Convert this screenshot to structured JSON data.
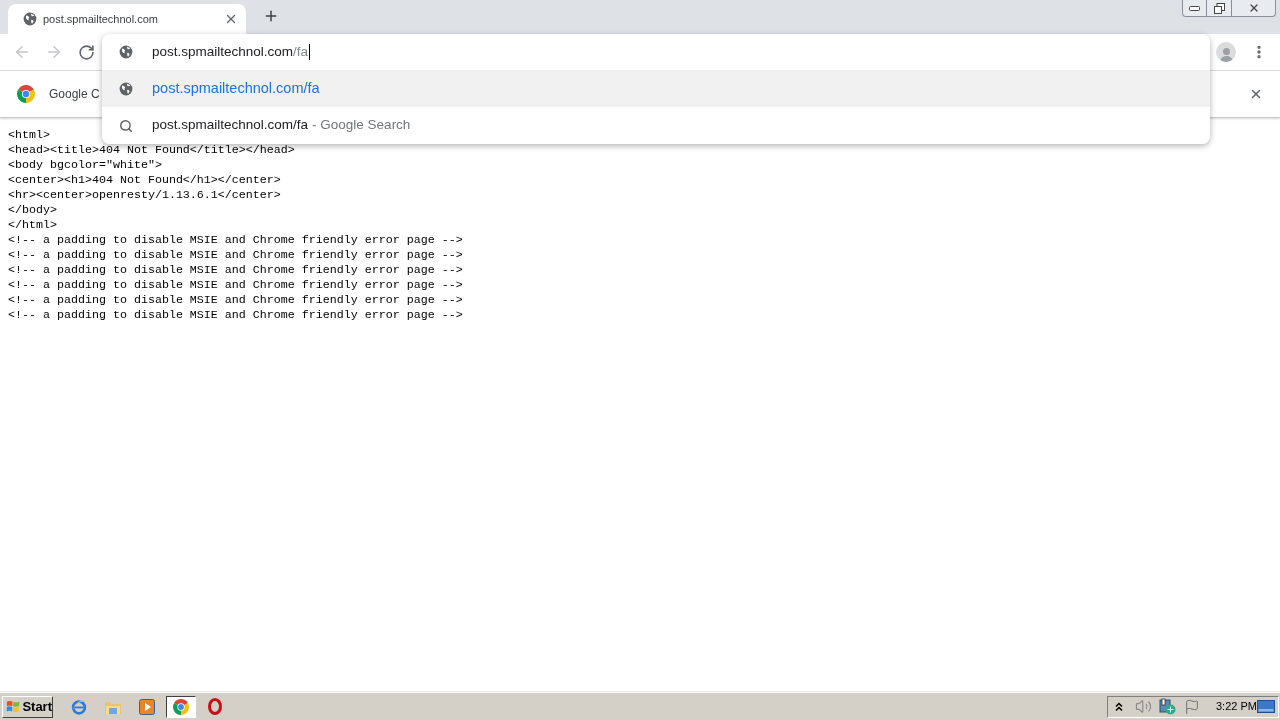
{
  "tabs": [
    {
      "title": "post.spmailtechnol.com",
      "selected": true
    }
  ],
  "toolbar": {
    "back": {
      "disabled": true
    },
    "forward": {
      "disabled": true
    }
  },
  "omnibox": {
    "host": "post.spmailtechnol.com",
    "path": "/fa"
  },
  "suggestions": [
    {
      "kind": "url",
      "text": "post.spmailtechnol.com/fa",
      "selected": true
    },
    {
      "kind": "search",
      "text": "post.spmailtechnol.com/fa",
      "suffix": "- Google Search",
      "selected": false
    }
  ],
  "infobar": {
    "text": "Google C"
  },
  "page_lines": [
    "<html>",
    "<head><title>404 Not Found</title></head>",
    "<body bgcolor=\"white\">",
    "<center><h1>404 Not Found</h1></center>",
    "<hr><center>openresty/1.13.6.1</center>",
    "</body>",
    "</html>",
    "<!-- a padding to disable MSIE and Chrome friendly error page -->",
    "<!-- a padding to disable MSIE and Chrome friendly error page -->",
    "<!-- a padding to disable MSIE and Chrome friendly error page -->",
    "<!-- a padding to disable MSIE and Chrome friendly error page -->",
    "<!-- a padding to disable MSIE and Chrome friendly error page -->",
    "<!-- a padding to disable MSIE and Chrome friendly error page -->"
  ],
  "taskbar": {
    "start_label": "Start",
    "apps": [
      {
        "kind": "ie",
        "selected": false
      },
      {
        "kind": "explorer",
        "selected": false
      },
      {
        "kind": "media",
        "selected": false
      },
      {
        "kind": "chrome",
        "selected": true
      },
      {
        "kind": "opera",
        "selected": false
      }
    ],
    "clock": "3:22 PM"
  }
}
